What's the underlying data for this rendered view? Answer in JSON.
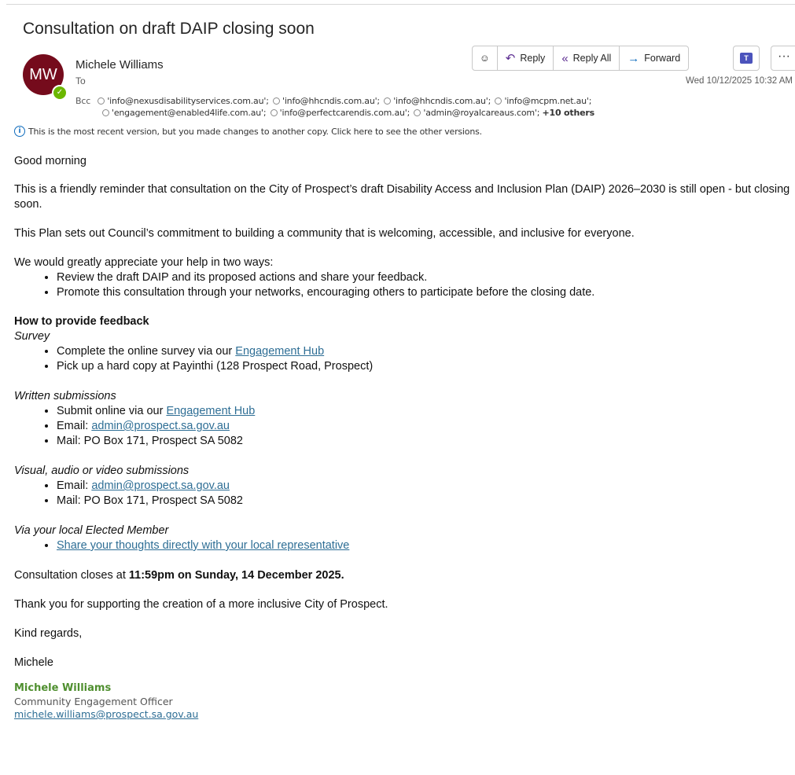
{
  "email": {
    "subject": "Consultation on draft DAIP closing soon",
    "avatar_initials": "MW",
    "sender": "Michele Williams",
    "to_label": "To",
    "bcc_label": "Bcc",
    "bcc_line1": [
      "'info@nexusdisabilityservices.com.au';",
      "'info@hhcndis.com.au';",
      "'info@hhcndis.com.au';",
      "'info@mcpm.net.au';"
    ],
    "bcc_line2": [
      "'engagement@enabled4life.com.au';",
      "'info@perfectcarendis.com.au';",
      "'admin@royalcareaus.com';"
    ],
    "bcc_more": "+10 others",
    "info_notice": "This is the most recent version, but you made changes to another copy. Click here to see the other versions.",
    "date": "Wed 10/12/2025 10:32 AM"
  },
  "toolbar": {
    "reply": "Reply",
    "reply_all": "Reply All",
    "forward": "Forward",
    "more": "···"
  },
  "body": {
    "greeting": "Good morning",
    "para1": "This is a friendly reminder that consultation on the City of Prospect’s draft Disability Access and Inclusion Plan (DAIP) 2026–2030 is still open - but closing soon.",
    "para2": "This Plan sets out Council’s commitment to building a community that is welcoming, accessible, and inclusive for everyone.",
    "para3": "We would greatly appreciate your help in two ways:",
    "ways": [
      "Review the draft DAIP and its proposed actions and share your feedback.",
      "Promote this consultation through your networks, encouraging others to participate before the closing date."
    ],
    "how_heading": "How to provide feedback",
    "survey_heading": "Survey",
    "survey_1_pre": "Complete the online survey via our ",
    "survey_1_link": "Engagement Hub",
    "survey_2": "Pick up a hard copy at Payinthi (128 Prospect Road, Prospect)",
    "written_heading": "Written submissions",
    "written_1_pre": "Submit online via our ",
    "written_1_link": "Engagement Hub",
    "written_2_pre": "Email: ",
    "written_2_link": "admin@prospect.sa.gov.au",
    "written_3": "Mail: PO Box 171, Prospect SA 5082",
    "visual_heading": "Visual, audio or video submissions",
    "visual_1_pre": "Email: ",
    "visual_1_link": "admin@prospect.sa.gov.au",
    "visual_2": "Mail: PO Box 171, Prospect SA 5082",
    "member_heading": "Via your local Elected Member",
    "member_1_link": "Share your thoughts directly with your local representative",
    "closes_pre": "Consultation closes at ",
    "closes_bold": "11:59pm on Sunday, 14 December 2025.",
    "thanks": "Thank you for supporting the creation of a more inclusive City of Prospect.",
    "regards": "Kind regards,",
    "signoff": "Michele",
    "sig_name": "Michele Williams",
    "sig_title": "Community Engagement Officer",
    "sig_email": "michele.williams@prospect.sa.gov.au"
  },
  "colors": {
    "avatar": "#750b1c",
    "presence": "#6bb700",
    "link": "#2e6e95",
    "signature": "#4f8f2f"
  }
}
